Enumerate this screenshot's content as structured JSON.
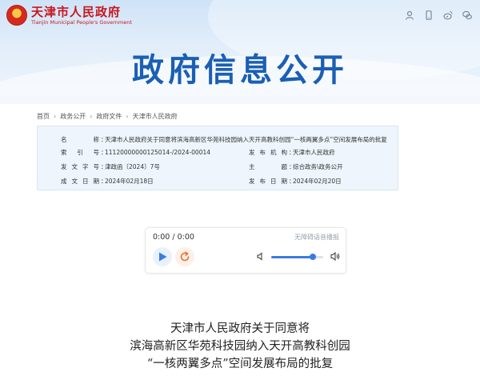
{
  "header": {
    "site_name_cn": "天津市人民政府",
    "site_name_en": "Tianjin Municipal People's Government",
    "banner_title": "政府信息公开",
    "icons": [
      "user-icon",
      "mobile-icon",
      "weibo-icon",
      "wechat-icon"
    ]
  },
  "breadcrumb": {
    "items": [
      "首页",
      "政务公开",
      "政府文件",
      "天津市人民政府"
    ],
    "separator": "›"
  },
  "info": {
    "name": {
      "label": "名称",
      "value": "天津市人民政府关于同意将滨海高新区华苑科技园纳入天开高教科创园“一核两翼多点”空间发展布局的批复"
    },
    "index_no": {
      "label": "索引号",
      "value": "11120000000125014-/2024-00014"
    },
    "publisher": {
      "label": "发布机构",
      "value": "天津市人民政府"
    },
    "doc_no": {
      "label": "发文字号",
      "value": "津政函〔2024〕7号"
    },
    "topic": {
      "label": "主题",
      "value": "综合政务\\政务公开"
    },
    "created": {
      "label": "成文日期",
      "value": "2024年02月18日"
    },
    "published": {
      "label": "发布日期",
      "value": "2024年02月20日"
    },
    "colon": "："
  },
  "player": {
    "time": "0:00 / 0:00",
    "tts_label": "无障碍语音播报",
    "volume": 0.8,
    "colors": {
      "play": "#3a7be0",
      "loop": "#f06d2c"
    }
  },
  "document": {
    "title_lines": [
      "天津市人民政府关于同意将",
      "滨海高新区华苑科技园纳入天开高教科创园",
      "“一核两翼多点”空间发展布局的批复"
    ]
  },
  "colors": {
    "brand_red": "#c8161d",
    "title_blue": "#1a5fb4",
    "info_bg": "#eef5fc"
  }
}
